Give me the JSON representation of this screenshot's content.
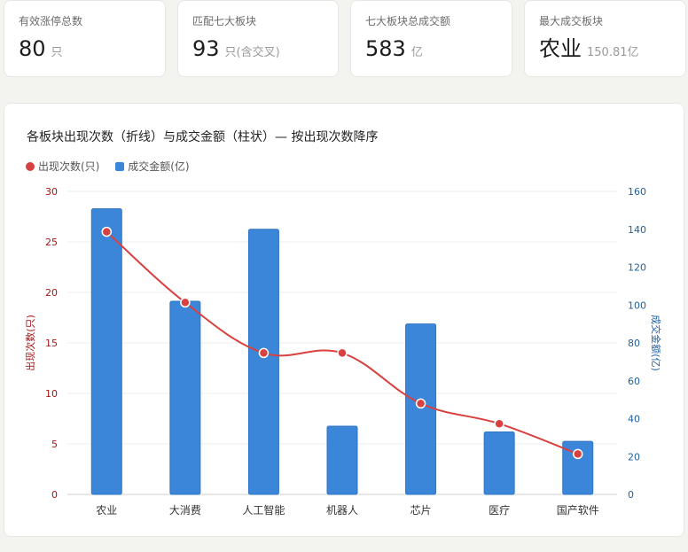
{
  "kpis": [
    {
      "label": "有效涨停总数",
      "value": "80",
      "unit": "只"
    },
    {
      "label": "匹配七大板块",
      "value": "93",
      "unit": "只(含交叉)"
    },
    {
      "label": "七大板块总成交额",
      "value": "583",
      "unit": "亿"
    },
    {
      "label": "最大成交板块",
      "value": "农业",
      "unit": "150.81亿"
    }
  ],
  "colors": {
    "line": "#d94040",
    "bar": "#3b86d8",
    "left_axis": "#a31515",
    "right_axis": "#1f5f9e"
  },
  "chart_data": {
    "type": "bar",
    "title": "各板块出现次数（折线）与成交金额（柱状）— 按出现次数降序",
    "categories": [
      "农业",
      "大消费",
      "人工智能",
      "机器人",
      "芯片",
      "医疗",
      "国产软件"
    ],
    "series": [
      {
        "name": "出现次数(只)",
        "type": "line",
        "axis": "left",
        "values": [
          26,
          19,
          14,
          14,
          9,
          7,
          4
        ]
      },
      {
        "name": "成交金额(亿)",
        "type": "bar",
        "axis": "right",
        "values": [
          150.81,
          102,
          140,
          36,
          90,
          33,
          28
        ]
      }
    ],
    "ylabel_left": "出现次数(只)",
    "ylabel_right": "成交金额(亿)",
    "ylim_left": [
      0,
      30
    ],
    "ylim_right": [
      0,
      160
    ],
    "yticks_left": [
      0,
      5,
      10,
      15,
      20,
      25,
      30
    ],
    "yticks_right": [
      0,
      20,
      40,
      60,
      80,
      100,
      120,
      140,
      160
    ],
    "grid": true,
    "legend": "top-left"
  }
}
